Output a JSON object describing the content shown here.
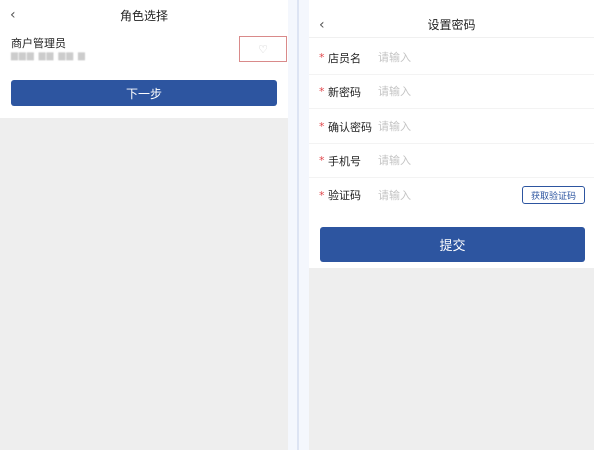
{
  "left": {
    "nav_title": "角色选择",
    "back_icon": "‹",
    "role": {
      "title": "商户管理员",
      "subtitle": "▆▆▆ ▆▆ ▆▆ ▆"
    },
    "radio_icon": "♡",
    "next_label": "下一步"
  },
  "right": {
    "nav_title": "设置密码",
    "back_icon": "‹",
    "fields": [
      {
        "required": "*",
        "label": "店员名",
        "placeholder": "请输入"
      },
      {
        "required": "*",
        "label": "新密码",
        "placeholder": "请输入"
      },
      {
        "required": "*",
        "label": "确认密码",
        "placeholder": "请输入"
      },
      {
        "required": "*",
        "label": "手机号",
        "placeholder": "请输入"
      },
      {
        "required": "*",
        "label": "验证码",
        "placeholder": "请输入"
      }
    ],
    "get_code_label": "获取验证码",
    "submit_label": "提交"
  },
  "colors": {
    "primary": "#2d55a0",
    "required": "#e0464b",
    "highlight_box": "#d98a8a"
  }
}
